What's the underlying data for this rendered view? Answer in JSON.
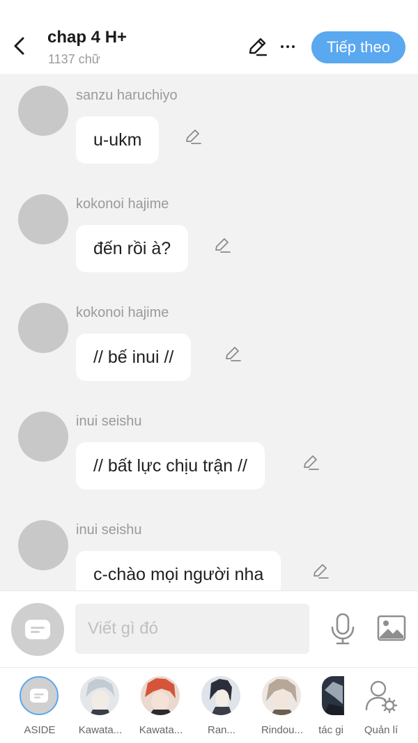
{
  "header": {
    "title": "chap 4 H+",
    "word_count": "1137 chữ",
    "next_label": "Tiếp theo"
  },
  "messages": [
    {
      "sender": "sanzu haruchiyo",
      "text": "u-ukm"
    },
    {
      "sender": "kokonoi hajime",
      "text": "đến rồi à?"
    },
    {
      "sender": "kokonoi hajime",
      "text": "// bế inui //"
    },
    {
      "sender": "inui seishu",
      "text": "// bất lực chịu trận //"
    },
    {
      "sender": "inui seishu",
      "text": "c-chào mọi người nha"
    }
  ],
  "composer": {
    "placeholder": "Viết gì đó"
  },
  "characters": [
    {
      "label": "ASIDE"
    },
    {
      "label": "Kawata..."
    },
    {
      "label": "Kawata..."
    },
    {
      "label": "Ran..."
    },
    {
      "label": "Rindou..."
    },
    {
      "label": "tác gi"
    },
    {
      "label": "Quản lí"
    }
  ],
  "colors": {
    "accent": "#5aa8f0",
    "background": "#f2f2f2",
    "avatar_placeholder": "#c8c8c8"
  }
}
